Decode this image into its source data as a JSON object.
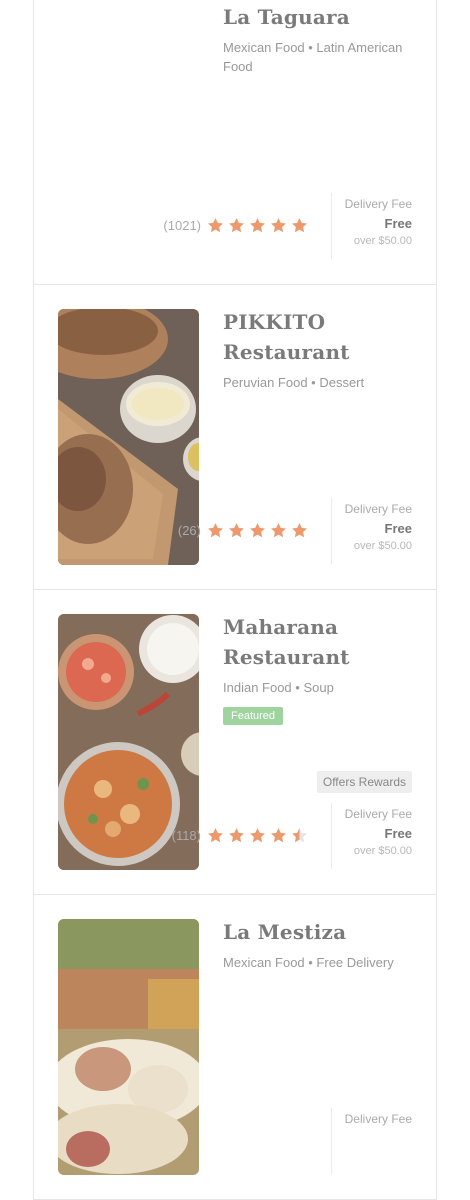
{
  "colors": {
    "star": "#ec9a6d",
    "star_empty": "#e4e4e4",
    "featured": "#9fd49f"
  },
  "restaurants": [
    {
      "name": "La Taguara",
      "cuisine": "Mexican Food • Latin American Food",
      "rating_count": "(1021)",
      "rating": 5,
      "delivery_label": "Delivery Fee",
      "delivery_value": "Free",
      "delivery_min": "over $50.00",
      "image": "none"
    },
    {
      "name": "PIKKITO Restaurant",
      "cuisine": "Peruvian Food • Dessert",
      "rating_count": "(26)",
      "rating": 5,
      "delivery_label": "Delivery Fee",
      "delivery_value": "Free",
      "delivery_min": "over $50.00",
      "image": "roast-chicken-photo"
    },
    {
      "name": "Maharana Restaurant",
      "cuisine": "Indian Food • Soup",
      "badge": "Featured",
      "rewards": "Offers Rewards",
      "rating_count": "(118)",
      "rating": 4.5,
      "delivery_label": "Delivery Fee",
      "delivery_value": "Free",
      "delivery_min": "over $50.00",
      "image": "curry-photo"
    },
    {
      "name": "La Mestiza",
      "cuisine": "Mexican Food • Free Delivery",
      "delivery_label": "Delivery Fee",
      "image": "tamales-photo"
    }
  ]
}
